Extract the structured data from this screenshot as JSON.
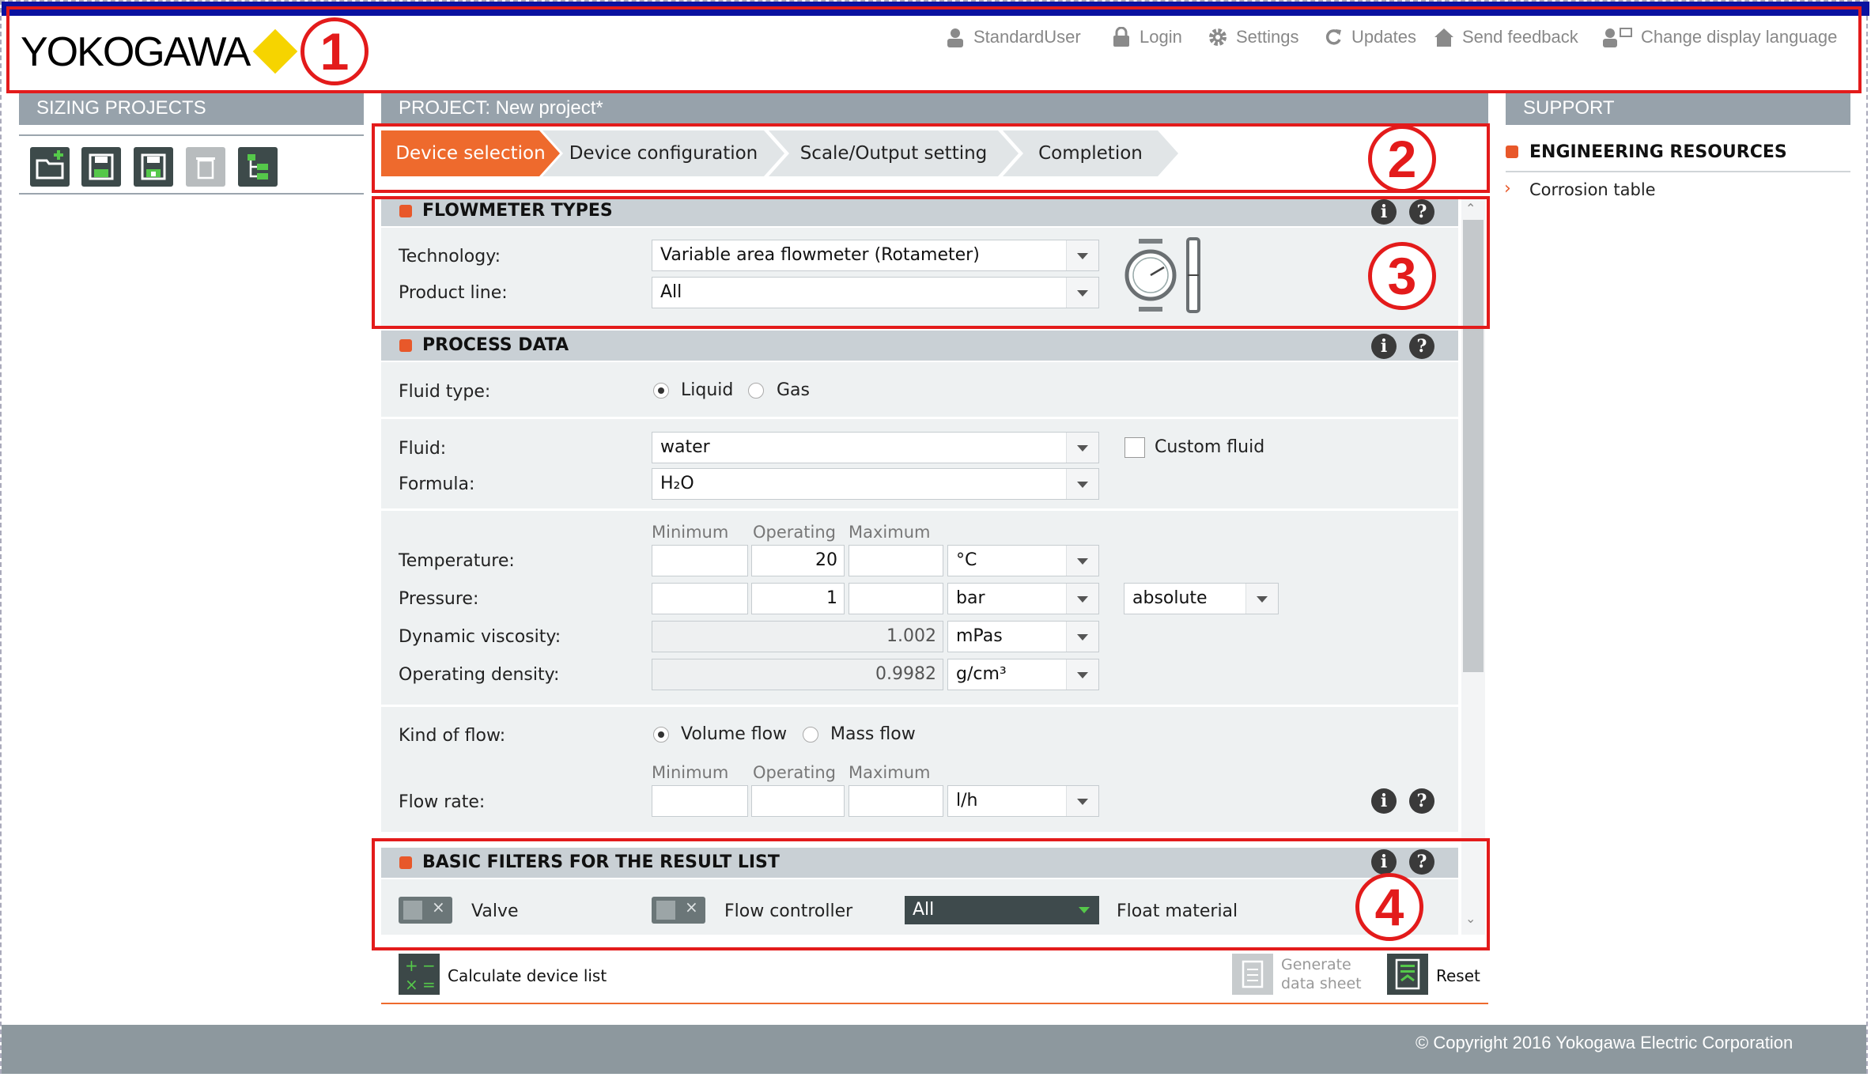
{
  "header": {
    "logo": "YOKOGAWA",
    "links": [
      {
        "label": "StandardUser",
        "icon": "user-icon"
      },
      {
        "label": "Login",
        "icon": "lock-icon"
      },
      {
        "label": "Settings",
        "icon": "gear-icon"
      },
      {
        "label": "Updates",
        "icon": "refresh-icon"
      },
      {
        "label": "Send feedback",
        "icon": "home-icon"
      },
      {
        "label": "Change display language",
        "icon": "language-icon"
      }
    ]
  },
  "annotations": [
    "1",
    "2",
    "3",
    "4"
  ],
  "sidebar": {
    "title": "SIZING PROJECTS",
    "tools": [
      "new-project-icon",
      "save-icon",
      "save-as-icon",
      "delete-icon",
      "tree-icon"
    ]
  },
  "project": {
    "title": "PROJECT: New project*",
    "steps": [
      "Device selection",
      "Device configuration",
      "Scale/Output setting",
      "Completion"
    ],
    "active_step": 0
  },
  "flowmeter": {
    "title": "FLOWMETER TYPES",
    "technology_label": "Technology:",
    "technology_value": "Variable area flowmeter (Rotameter)",
    "product_line_label": "Product line:",
    "product_line_value": "All"
  },
  "process": {
    "title": "PROCESS DATA",
    "fluid_type_label": "Fluid type:",
    "fluid_type_options": [
      "Liquid",
      "Gas"
    ],
    "fluid_type_selected": "Liquid",
    "fluid_label": "Fluid:",
    "fluid_value": "water",
    "custom_fluid_label": "Custom fluid",
    "formula_label": "Formula:",
    "formula_value": "H₂O",
    "col_min": "Minimum",
    "col_op": "Operating",
    "col_max": "Maximum",
    "temperature_label": "Temperature:",
    "temperature_op": "20",
    "temperature_unit": "°C",
    "pressure_label": "Pressure:",
    "pressure_op": "1",
    "pressure_unit": "bar",
    "pressure_mode": "absolute",
    "viscosity_label": "Dynamic viscosity:",
    "viscosity_value": "1.002",
    "viscosity_unit": "mPas",
    "density_label": "Operating density:",
    "density_value": "0.9982",
    "density_unit": "g/cm³",
    "kind_label": "Kind of flow:",
    "kind_options": [
      "Volume flow",
      "Mass flow"
    ],
    "kind_selected": "Volume flow",
    "flow_label": "Flow rate:",
    "flow_unit": "l/h"
  },
  "filters": {
    "title": "BASIC FILTERS FOR THE RESULT LIST",
    "valve_label": "Valve",
    "flow_controller_label": "Flow controller",
    "float_material_value": "All",
    "float_material_label": "Float material"
  },
  "actions": {
    "calculate": "Calculate device list",
    "generate_line1": "Generate",
    "generate_line2": "data sheet",
    "reset": "Reset"
  },
  "support": {
    "title": "SUPPORT",
    "section": "ENGINEERING RESOURCES",
    "link": "Corrosion table"
  },
  "footer": {
    "copyright": "© Copyright 2016 Yokogawa Electric Corporation"
  },
  "colors": {
    "accent": "#ee6a2d",
    "annotation": "#e31b1b",
    "topbar": "#0a12a0",
    "section": "#97a2ab"
  }
}
